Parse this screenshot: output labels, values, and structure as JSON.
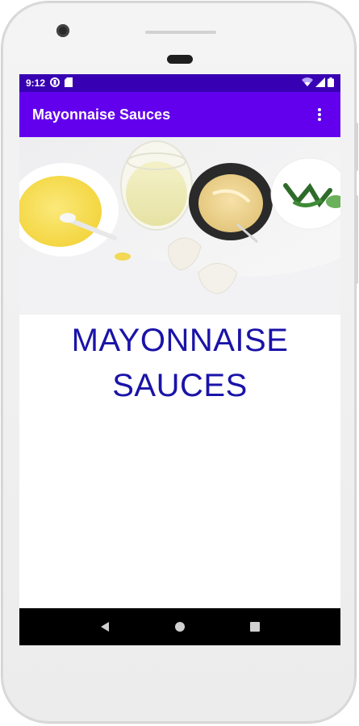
{
  "status_bar": {
    "time": "9:12",
    "left_icons": [
      "data-saver-icon",
      "sd-card-icon"
    ],
    "right_icons": [
      "wifi-icon",
      "signal-icon",
      "battery-icon"
    ]
  },
  "app_bar": {
    "title": "Mayonnaise Sauces",
    "menu_icon": "overflow-menu-icon"
  },
  "hero_image": {
    "description_icon": "mayonnaise-ingredients-image"
  },
  "main": {
    "title_line_1": "MAYONNAISE",
    "title_line_2": "SAUCES"
  },
  "nav_bar": {
    "buttons": [
      "back-icon",
      "home-icon",
      "recents-icon"
    ]
  },
  "colors": {
    "status_bar": "#3700b3",
    "app_bar": "#6200ee",
    "title_text": "#1a13a8",
    "nav_bar": "#000000"
  }
}
